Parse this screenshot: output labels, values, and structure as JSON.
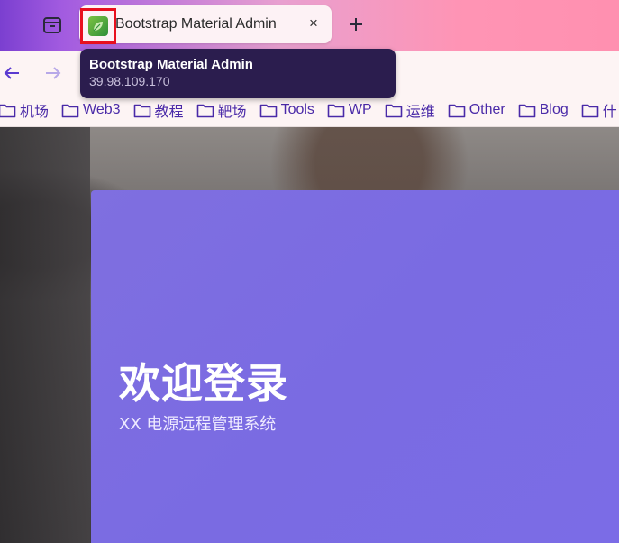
{
  "tab": {
    "title": "Bootstrap Material Admin",
    "close_glyph": "×",
    "favicon_icon": "leaf-icon"
  },
  "tooltip": {
    "title": "Bootstrap Material Admin",
    "url": "39.98.109.170"
  },
  "bookmarks": [
    "机场",
    "Web3",
    "教程",
    "靶场",
    "Tools",
    "WP",
    "运维",
    "Other",
    "Blog",
    "什"
  ],
  "page": {
    "welcome": "欢迎登录",
    "subtitle": "XX 电源远程管理系统"
  },
  "colors": {
    "tab_gradient_start": "#7b3fd0",
    "tab_gradient_end": "#ff90b0",
    "tooltip_bg": "#2b1d4e",
    "bookmark_text": "#4a2aa8",
    "login_panel": "#7b6ce4",
    "highlight_box": "#e8101e"
  }
}
